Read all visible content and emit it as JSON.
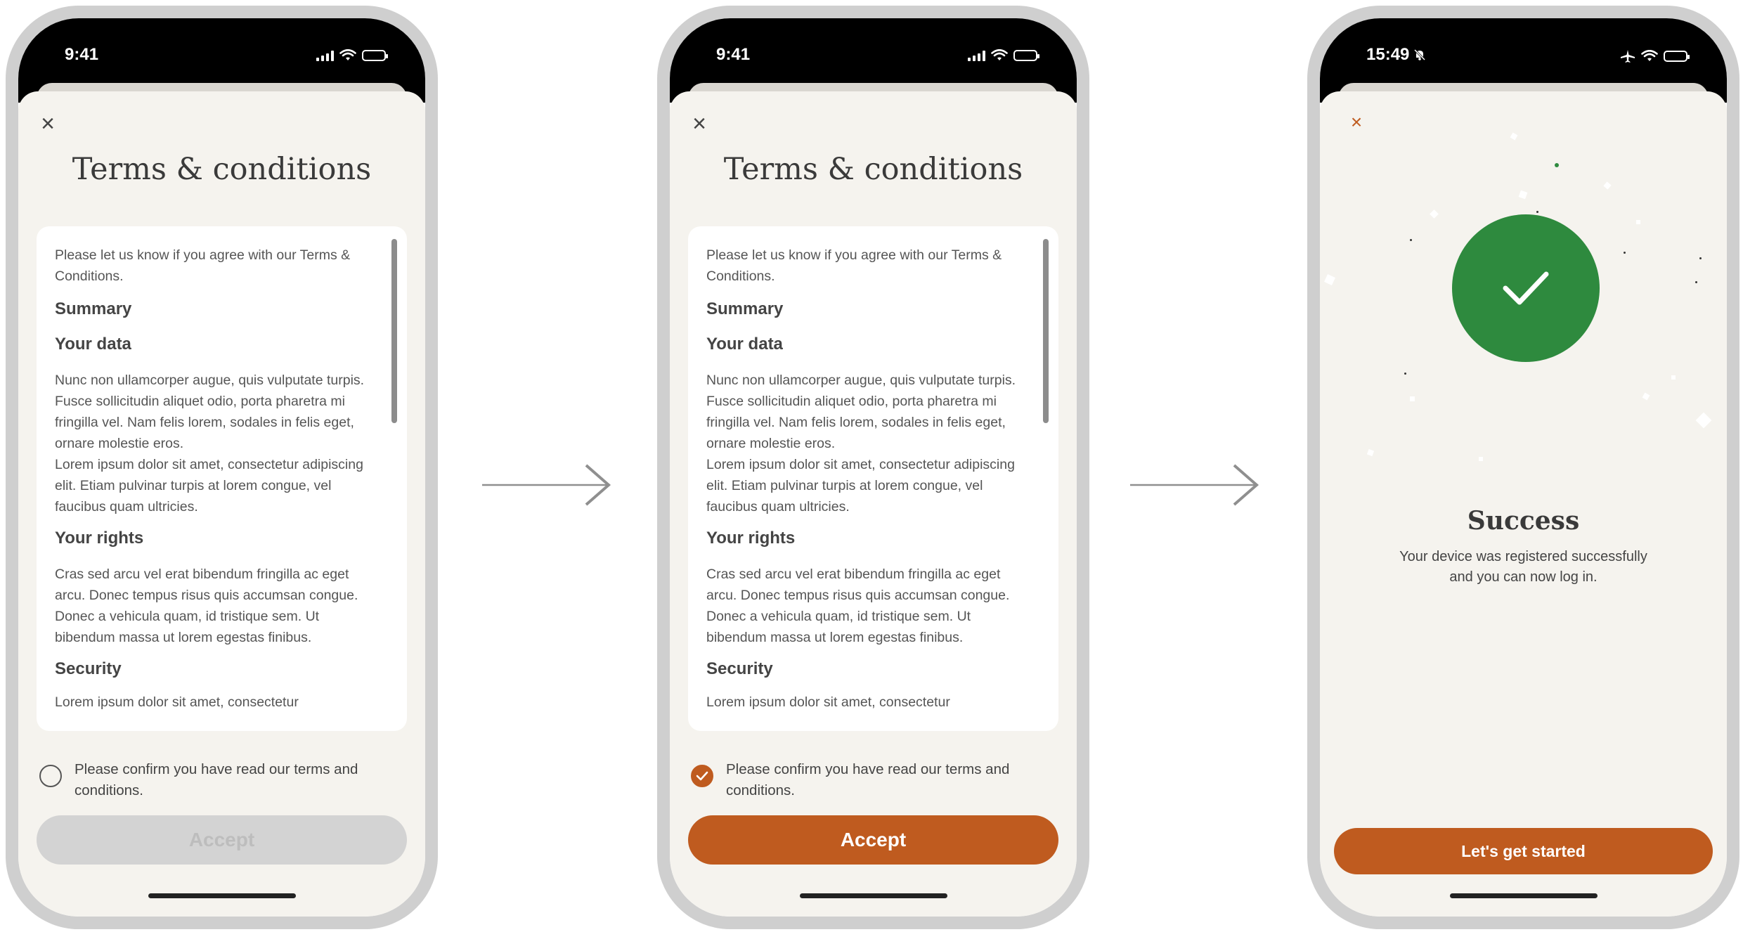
{
  "status": {
    "time_1": "9:41",
    "time_2": "9:41",
    "time_3": "15:49"
  },
  "terms": {
    "title": "Terms & conditions",
    "intro": "Please let us know if you agree with our Terms & Conditions.",
    "summary_heading": "Summary",
    "your_data_heading": "Your data",
    "your_data_text": "Nunc non ullamcorper augue, quis vulputate turpis.  Fusce sollicitudin aliquet odio, porta pharetra mi fringilla vel. Nam felis lorem, sodales in felis eget, ornare molestie eros.",
    "your_data_text_2": "Lorem ipsum dolor sit amet, consectetur adipiscing elit. Etiam pulvinar turpis at lorem congue, vel faucibus quam ultricies.",
    "your_rights_heading": "Your rights",
    "your_rights_text": "Cras sed arcu vel erat bibendum fringilla ac eget arcu. Donec tempus risus quis accumsan congue. Donec a vehicula quam, id tristique sem. Ut bibendum massa ut lorem egestas finibus.",
    "security_heading": "Security",
    "security_text": "Lorem ipsum dolor sit amet, consectetur",
    "confirm_label": "Please confirm you have read our terms and conditions.",
    "accept_label": "Accept"
  },
  "success": {
    "title": "Success",
    "message": "Your device was registered successfully and you can now log in.",
    "start_label": "Let's get started"
  },
  "icons": {
    "close": "close-icon",
    "check": "checkmark-icon",
    "arrow": "arrow-right-icon",
    "wifi": "wifi-icon",
    "battery": "battery-icon",
    "signal": "signal-icon",
    "airplane": "airplane-icon",
    "mute": "bell-slash-icon"
  },
  "colors": {
    "accent": "#bf5b1f",
    "success": "#2e8a3e",
    "background": "#f5f3ee",
    "disabled": "#d3d3d3"
  }
}
